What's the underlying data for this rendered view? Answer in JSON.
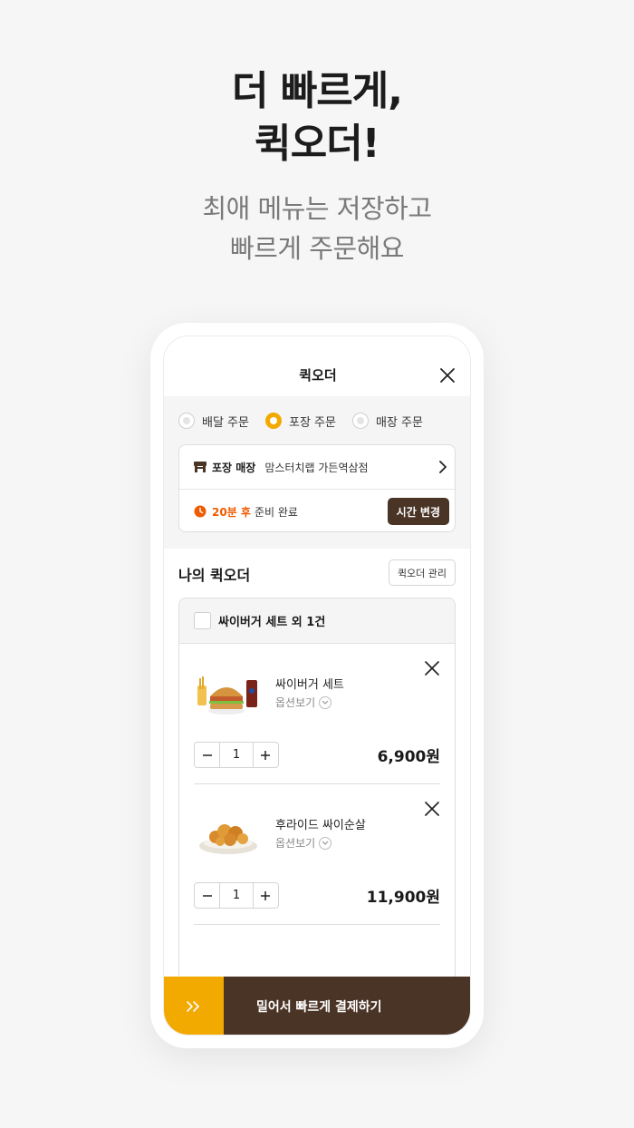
{
  "hero": {
    "title_line1": "더 빠르게,",
    "title_line2": "퀵오더!",
    "sub_line1": "최애 메뉴는 저장하고",
    "sub_line2": "빠르게 주문해요"
  },
  "screen": {
    "title": "퀵오더",
    "order_types": [
      {
        "label": "배달 주문",
        "selected": false
      },
      {
        "label": "포장 주문",
        "selected": true
      },
      {
        "label": "매장 주문",
        "selected": false
      }
    ],
    "store": {
      "tag": "포장 매장",
      "name": "맘스터치랩 가든역삼점"
    },
    "time": {
      "accent": "20분 후",
      "text": "준비 완료",
      "button": "시간 변경"
    },
    "my_quick_order": {
      "title": "나의 퀵오더",
      "manage_button": "퀵오더 관리"
    },
    "quick_order_card": {
      "header_label": "싸이버거 세트 외 1건",
      "items": [
        {
          "name": "싸이버거 세트",
          "option_label": "옵션보기",
          "quantity": "1",
          "price": "6,900원",
          "image": "burger-set"
        },
        {
          "name": "후라이드 싸이순살",
          "option_label": "옵션보기",
          "quantity": "1",
          "price": "11,900원",
          "image": "fried-chicken"
        }
      ]
    },
    "pay_button": "밀어서 빠르게 결제하기"
  },
  "colors": {
    "accent": "#f2a900",
    "brown": "#4a3426",
    "orange_text": "#f05a00"
  },
  "icons": [
    "close-icon",
    "store-icon",
    "chevron-right-icon",
    "clock-icon",
    "chevron-down-icon",
    "minus-icon",
    "plus-icon",
    "double-chevron-right-icon"
  ]
}
